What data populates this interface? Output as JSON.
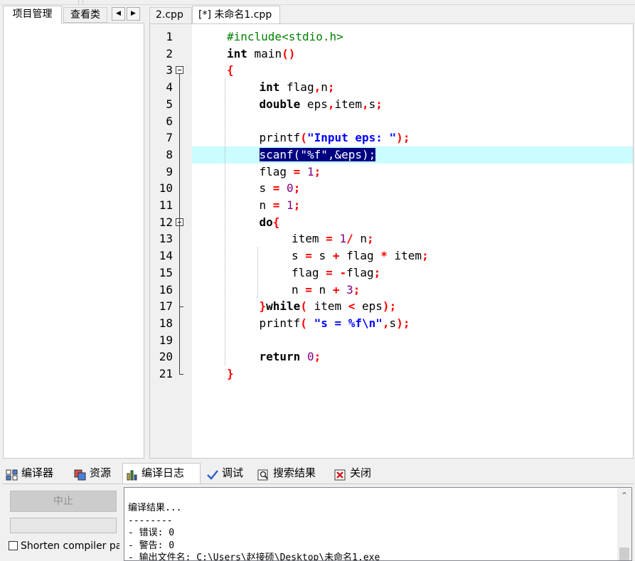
{
  "left_tabs": [
    "项目管理",
    "查看类"
  ],
  "nav": {
    "prev": "◀",
    "next": "▶"
  },
  "editor_tabs": [
    "2.cpp",
    "[*] 未命名1.cpp"
  ],
  "code": {
    "line_numbers": [
      "1",
      "2",
      "3",
      "4",
      "5",
      "6",
      "7",
      "8",
      "9",
      "10",
      "11",
      "12",
      "13",
      "14",
      "15",
      "16",
      "17",
      "18",
      "19",
      "20",
      "21"
    ],
    "highlighted_line": 8,
    "lines": [
      {
        "n": 1,
        "tokens": [
          [
            "#include<stdio.h>",
            "pp"
          ]
        ]
      },
      {
        "n": 2,
        "tokens": [
          [
            "int",
            "kw"
          ],
          [
            " main",
            ""
          ],
          [
            "()",
            "op"
          ]
        ]
      },
      {
        "n": 3,
        "tokens": [
          [
            "{",
            "op"
          ]
        ]
      },
      {
        "n": 4,
        "indent": 1,
        "tokens": [
          [
            "int",
            "kw"
          ],
          [
            " flag",
            ""
          ],
          [
            ",",
            "op"
          ],
          [
            "n",
            ""
          ],
          [
            ";",
            "op"
          ]
        ]
      },
      {
        "n": 5,
        "indent": 1,
        "tokens": [
          [
            "double",
            "kw"
          ],
          [
            " eps",
            ""
          ],
          [
            ",",
            "op"
          ],
          [
            "item",
            ""
          ],
          [
            ",",
            "op"
          ],
          [
            "s",
            ""
          ],
          [
            ";",
            "op"
          ]
        ]
      },
      {
        "n": 6,
        "tokens": []
      },
      {
        "n": 7,
        "indent": 1,
        "tokens": [
          [
            "printf",
            ""
          ],
          [
            "(",
            "op"
          ],
          [
            "\"Input eps: \"",
            "str"
          ],
          [
            ")",
            "op"
          ],
          [
            ";",
            "op"
          ]
        ]
      },
      {
        "n": 8,
        "indent": 1,
        "selected": true,
        "tokens": [
          [
            "scanf",
            ""
          ],
          [
            "(",
            ""
          ],
          [
            "\"%f\"",
            ""
          ],
          [
            ",",
            ""
          ],
          [
            "&eps",
            ""
          ],
          [
            ")",
            ""
          ],
          [
            ";",
            ""
          ]
        ]
      },
      {
        "n": 9,
        "indent": 1,
        "tokens": [
          [
            "flag ",
            ""
          ],
          [
            "=",
            "op"
          ],
          [
            " ",
            ""
          ],
          [
            "1",
            "num"
          ],
          [
            ";",
            "op"
          ]
        ]
      },
      {
        "n": 10,
        "indent": 1,
        "tokens": [
          [
            "s ",
            ""
          ],
          [
            "=",
            "op"
          ],
          [
            " ",
            ""
          ],
          [
            "0",
            "num"
          ],
          [
            ";",
            "op"
          ]
        ]
      },
      {
        "n": 11,
        "indent": 1,
        "tokens": [
          [
            "n ",
            ""
          ],
          [
            "=",
            "op"
          ],
          [
            " ",
            ""
          ],
          [
            "1",
            "num"
          ],
          [
            ";",
            "op"
          ]
        ]
      },
      {
        "n": 12,
        "indent": 1,
        "tokens": [
          [
            "do",
            "kw"
          ],
          [
            "{",
            "op"
          ]
        ]
      },
      {
        "n": 13,
        "indent": 2,
        "tokens": [
          [
            "item ",
            ""
          ],
          [
            "=",
            "op"
          ],
          [
            " ",
            ""
          ],
          [
            "1",
            "num"
          ],
          [
            "/",
            "op"
          ],
          [
            " n",
            ""
          ],
          [
            ";",
            "op"
          ]
        ]
      },
      {
        "n": 14,
        "indent": 2,
        "tokens": [
          [
            "s ",
            ""
          ],
          [
            "=",
            "op"
          ],
          [
            " s ",
            ""
          ],
          [
            "+",
            "op"
          ],
          [
            " flag ",
            ""
          ],
          [
            "*",
            "op"
          ],
          [
            " item",
            ""
          ],
          [
            ";",
            "op"
          ]
        ]
      },
      {
        "n": 15,
        "indent": 2,
        "tokens": [
          [
            "flag ",
            ""
          ],
          [
            "=",
            "op"
          ],
          [
            " ",
            ""
          ],
          [
            "-",
            "op"
          ],
          [
            "flag",
            ""
          ],
          [
            ";",
            "op"
          ]
        ]
      },
      {
        "n": 16,
        "indent": 2,
        "tokens": [
          [
            "n ",
            ""
          ],
          [
            "=",
            "op"
          ],
          [
            " n ",
            ""
          ],
          [
            "+",
            "op"
          ],
          [
            " ",
            ""
          ],
          [
            "3",
            "num"
          ],
          [
            ";",
            "op"
          ]
        ]
      },
      {
        "n": 17,
        "indent": 1,
        "tokens": [
          [
            "}",
            "op"
          ],
          [
            "while",
            "kw"
          ],
          [
            "(",
            "op"
          ],
          [
            " item ",
            ""
          ],
          [
            "<",
            "op"
          ],
          [
            " eps",
            ""
          ],
          [
            ")",
            "op"
          ],
          [
            ";",
            "op"
          ]
        ]
      },
      {
        "n": 18,
        "indent": 1,
        "tokens": [
          [
            "printf",
            ""
          ],
          [
            "(",
            "op"
          ],
          [
            " ",
            ""
          ],
          [
            "\"s = %f\\n\"",
            "str"
          ],
          [
            ",",
            "op"
          ],
          [
            "s",
            ""
          ],
          [
            ")",
            "op"
          ],
          [
            ";",
            "op"
          ]
        ]
      },
      {
        "n": 19,
        "tokens": []
      },
      {
        "n": 20,
        "indent": 1,
        "tokens": [
          [
            "return",
            "kw"
          ],
          [
            " ",
            ""
          ],
          [
            "0",
            "num"
          ],
          [
            ";",
            "op"
          ]
        ]
      },
      {
        "n": 21,
        "tokens": [
          [
            "}",
            "op"
          ]
        ]
      }
    ]
  },
  "bottom_tabs": [
    {
      "label": "编译器",
      "icon": "grid-icon"
    },
    {
      "label": "资源",
      "icon": "resources-icon"
    },
    {
      "label": "编译日志",
      "icon": "bar-chart-icon"
    },
    {
      "label": "调试",
      "icon": "checkmark-icon"
    },
    {
      "label": "搜索结果",
      "icon": "search-icon"
    },
    {
      "label": "关闭",
      "icon": "close-icon"
    }
  ],
  "compile": {
    "stop_label": "中止",
    "shorten_label": "Shorten compiler paths",
    "log_lines": [
      "编译结果...",
      "--------",
      "- 错误: 0",
      "- 警告: 0",
      "- 输出文件名: C:\\Users\\赵接硕\\Desktop\\未命名1.exe"
    ]
  },
  "colors": {
    "highlight_line": "#cbfcff",
    "selection": "#000080",
    "keyword": "#000000",
    "operator": "#ff0000",
    "string": "#0000ff",
    "number": "#800080",
    "preprocessor": "#008000"
  }
}
